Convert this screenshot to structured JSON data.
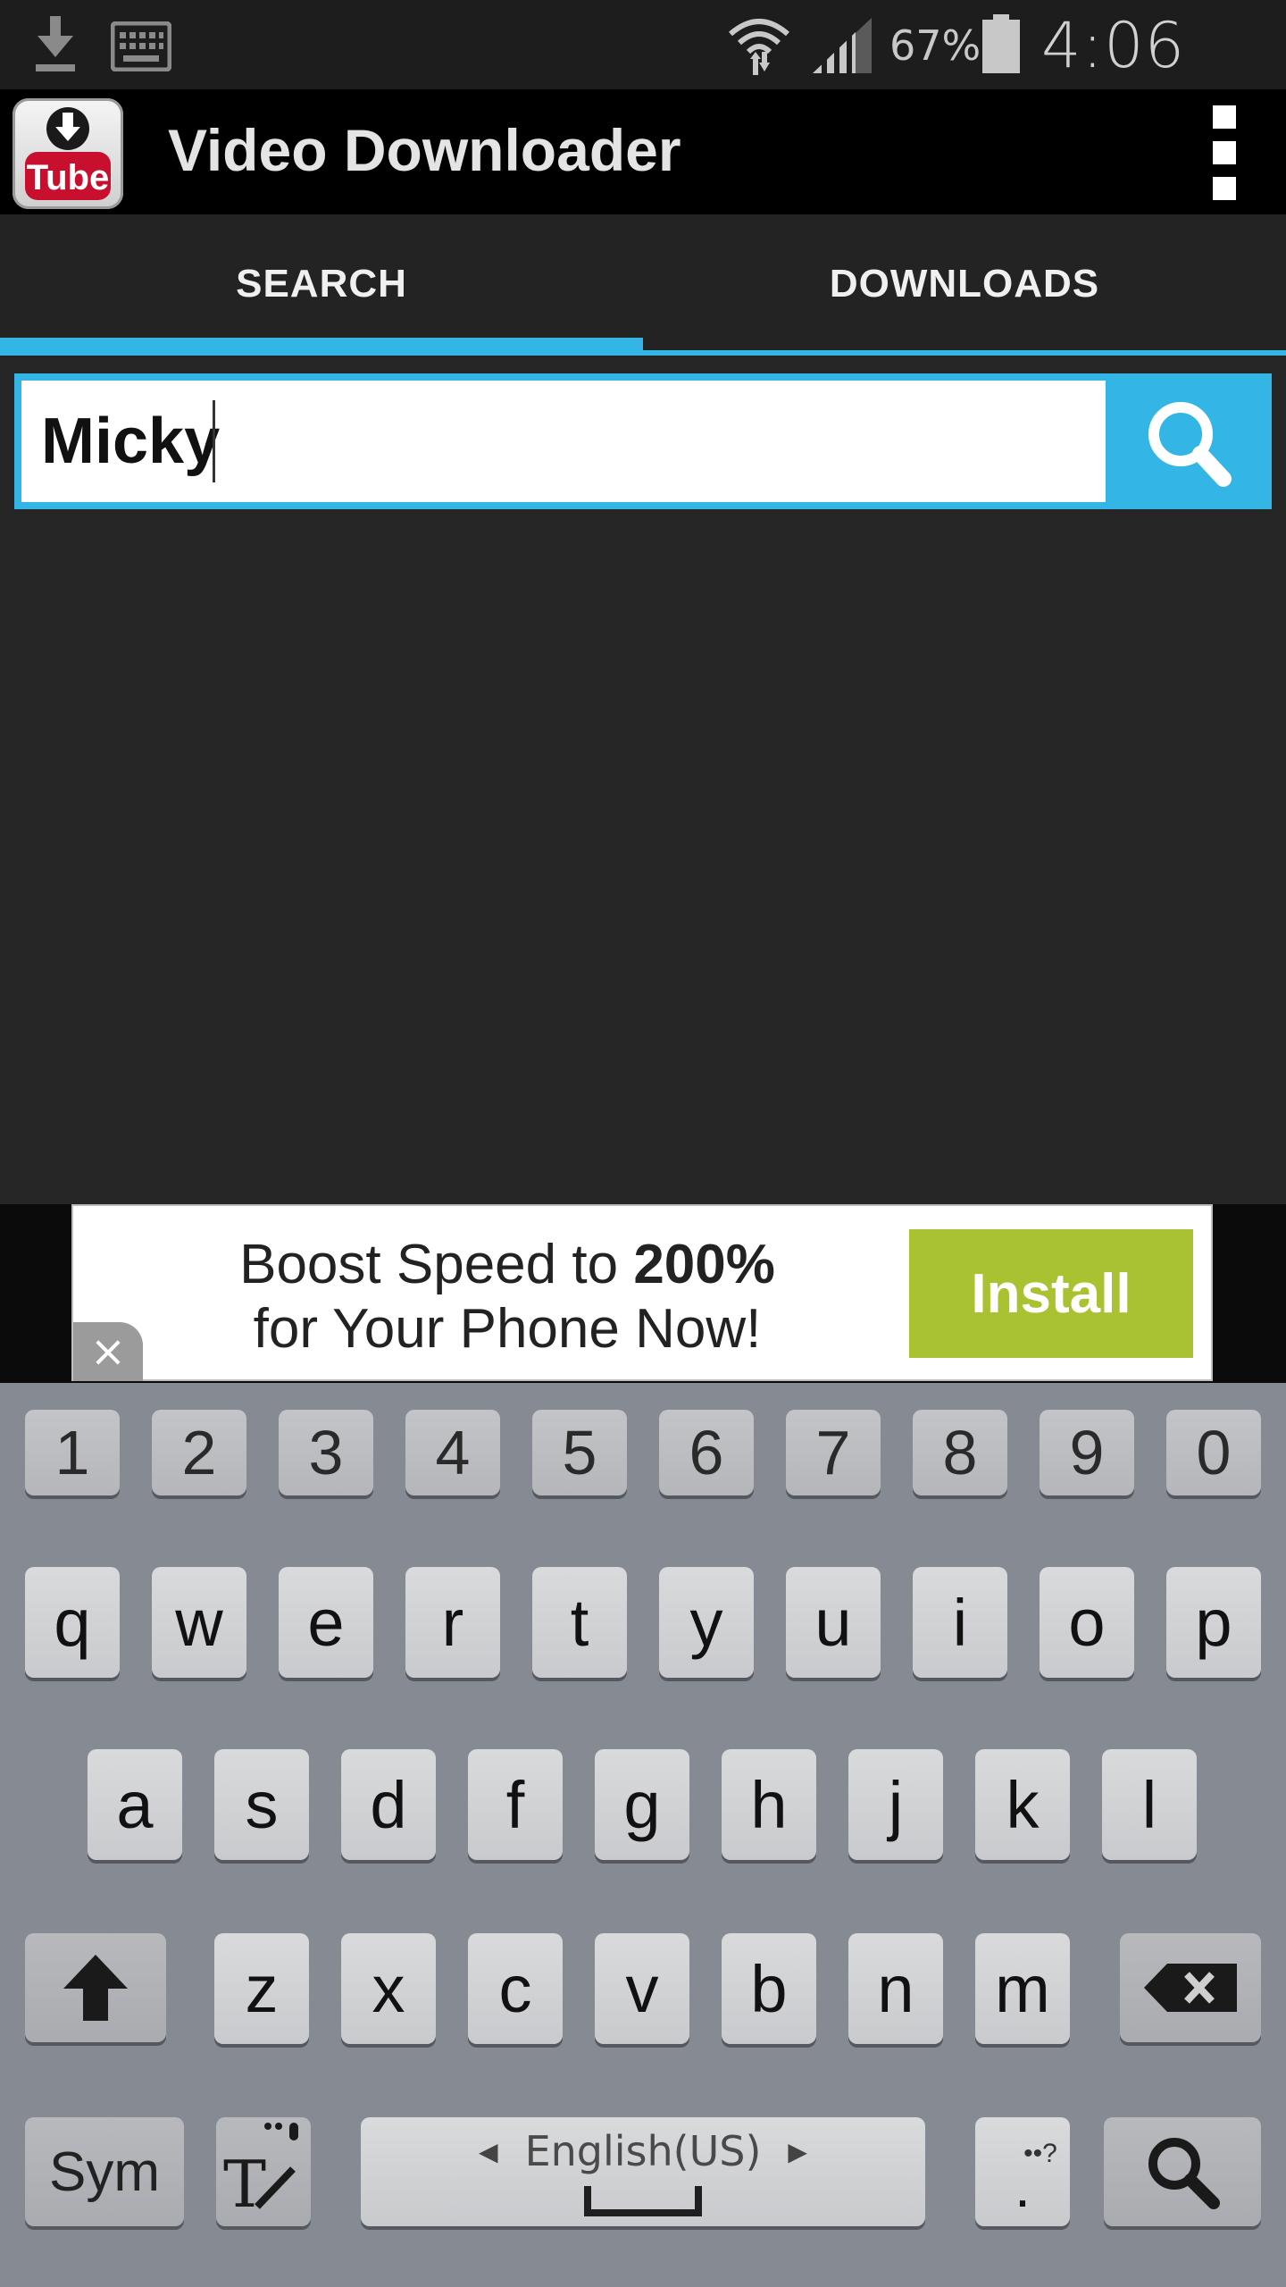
{
  "status_bar": {
    "battery_percent": "67%",
    "time": "4:06 PM",
    "icons": [
      "download-icon",
      "keyboard-icon",
      "wifi-icon",
      "signal-icon",
      "battery-icon"
    ]
  },
  "action_bar": {
    "title": "Video Downloader",
    "logo_text": "Tube"
  },
  "tabs": [
    {
      "label": "SEARCH",
      "selected": true
    },
    {
      "label": "DOWNLOADS",
      "selected": false
    }
  ],
  "search": {
    "value": "Micky",
    "button_icon": "search-icon"
  },
  "ad": {
    "line1_prefix": "Boost Speed to ",
    "line1_bold": "200%",
    "line2": "for Your Phone Now!",
    "install_label": "Install",
    "close_label": "×"
  },
  "keyboard": {
    "row_numbers": [
      "1",
      "2",
      "3",
      "4",
      "5",
      "6",
      "7",
      "8",
      "9",
      "0"
    ],
    "row_top": [
      "q",
      "w",
      "e",
      "r",
      "t",
      "y",
      "u",
      "i",
      "o",
      "p"
    ],
    "row_middle": [
      "a",
      "s",
      "d",
      "f",
      "g",
      "h",
      "j",
      "k",
      "l"
    ],
    "row_bottom": [
      "z",
      "x",
      "c",
      "v",
      "b",
      "n",
      "m"
    ],
    "sym_label": "Sym",
    "language_label": "English(US)",
    "period_label": ".",
    "period_hint": "••?"
  },
  "colors": {
    "accent": "#33b5e5",
    "ad_install": "#a8c232",
    "keyboard_bg": "#868a92"
  }
}
